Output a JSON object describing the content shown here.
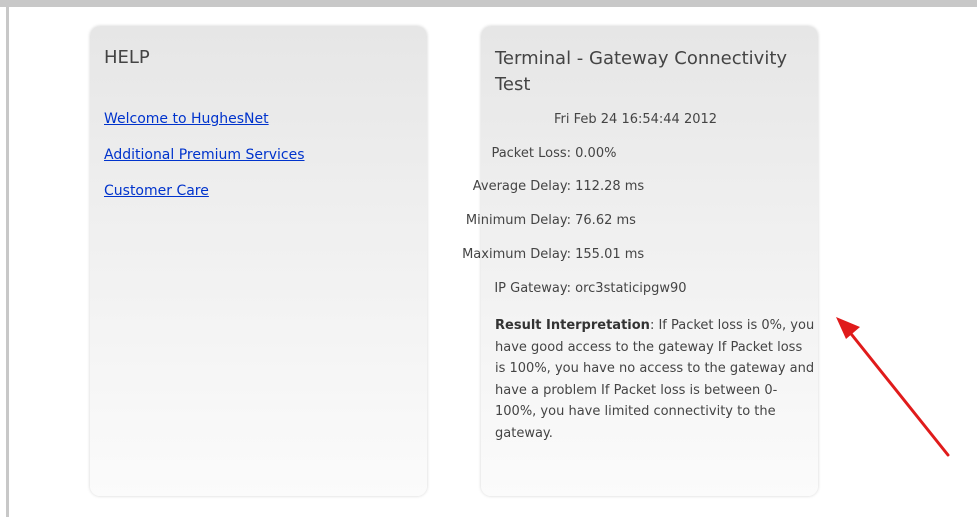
{
  "help": {
    "title": "HELP",
    "links": [
      {
        "label": "Welcome to HughesNet"
      },
      {
        "label": "Additional Premium Services"
      },
      {
        "label": "Customer Care"
      }
    ]
  },
  "test": {
    "title": "Terminal - Gateway Connectivity Test",
    "timestamp": "Fri Feb 24 16:54:44 2012",
    "stats": [
      {
        "label": "Packet Loss:",
        "value": "0.00%"
      },
      {
        "label": "Average Delay:",
        "value": "112.28 ms"
      },
      {
        "label": "Minimum Delay:",
        "value": "76.62 ms"
      },
      {
        "label": "Maximum Delay:",
        "value": "155.01 ms"
      },
      {
        "label": "IP Gateway:",
        "value": "orc3staticipgw90"
      }
    ],
    "interpretation_heading": "Result Interpretation",
    "interpretation_text": ": If Packet loss is 0%, you have good access to the gateway If Packet loss is 100%, you have no access to the gateway and have a problem If Packet loss is between 0-100%, you have limited connectivity to the gateway."
  },
  "colors": {
    "link": "#0033cc",
    "text": "#444444",
    "annotation_arrow": "#e01b1b"
  },
  "icons": {
    "annotation": "red-arrow-icon"
  }
}
